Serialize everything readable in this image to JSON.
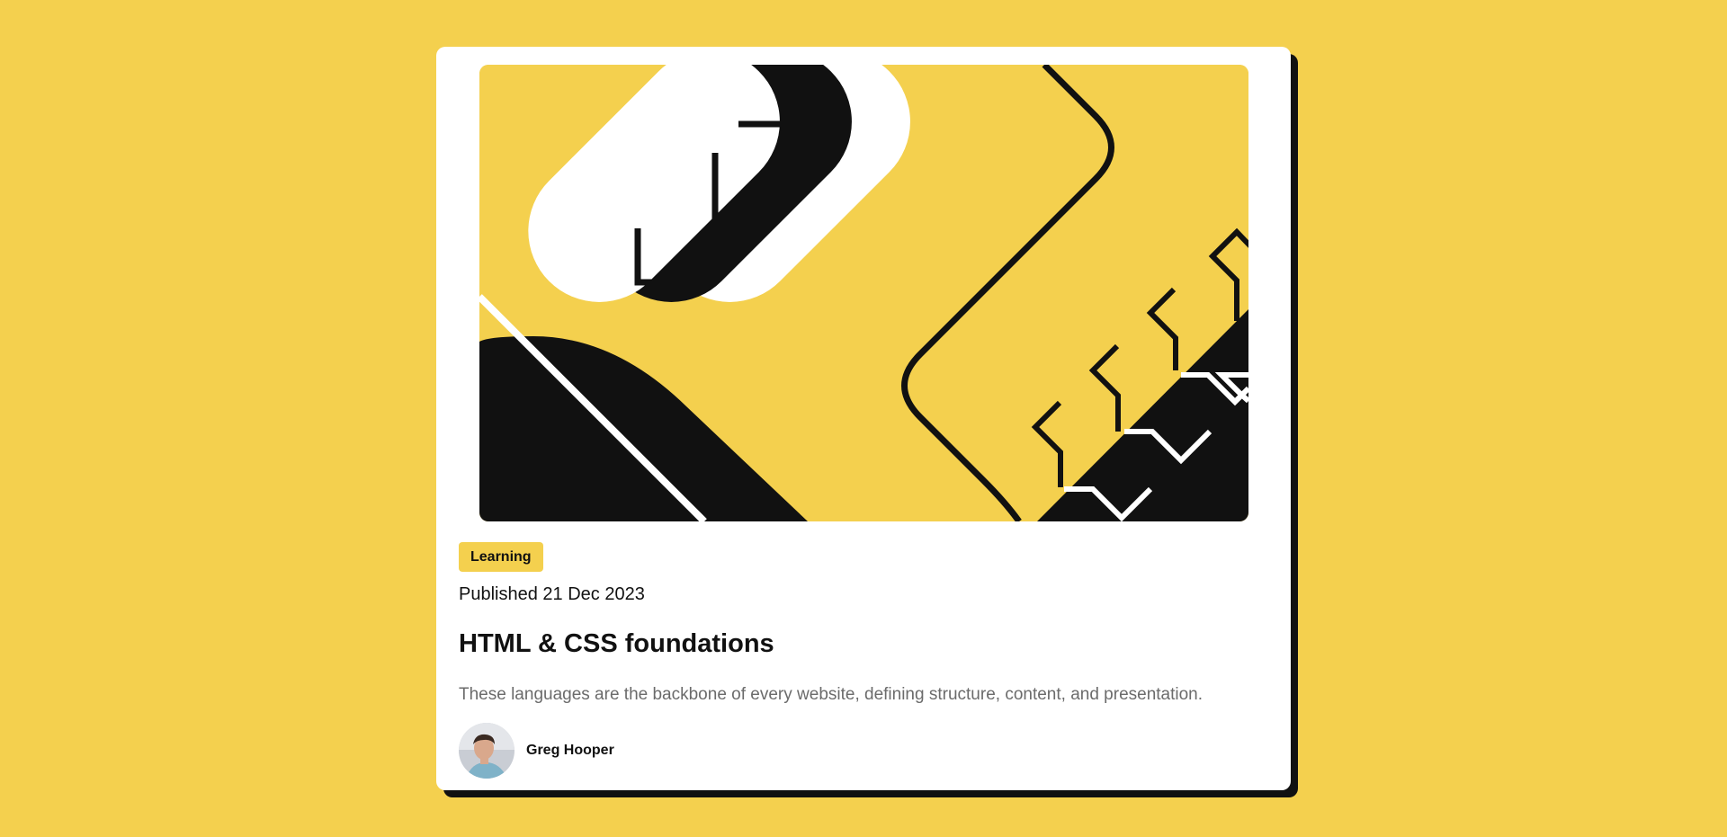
{
  "card": {
    "tag": "Learning",
    "published": "Published 21 Dec 2023",
    "title": "HTML & CSS foundations",
    "description": "These languages are the backbone of every website, defining structure, content, and presentation.",
    "author": "Greg Hooper"
  },
  "colors": {
    "page_background": "#F4D04E",
    "card_background": "#FFFFFF",
    "ink": "#111111",
    "muted_text": "#6B6B6B",
    "accent": "#F4D04E"
  },
  "icons": {
    "hero": "abstract-illustration",
    "avatar": "author-photo"
  }
}
